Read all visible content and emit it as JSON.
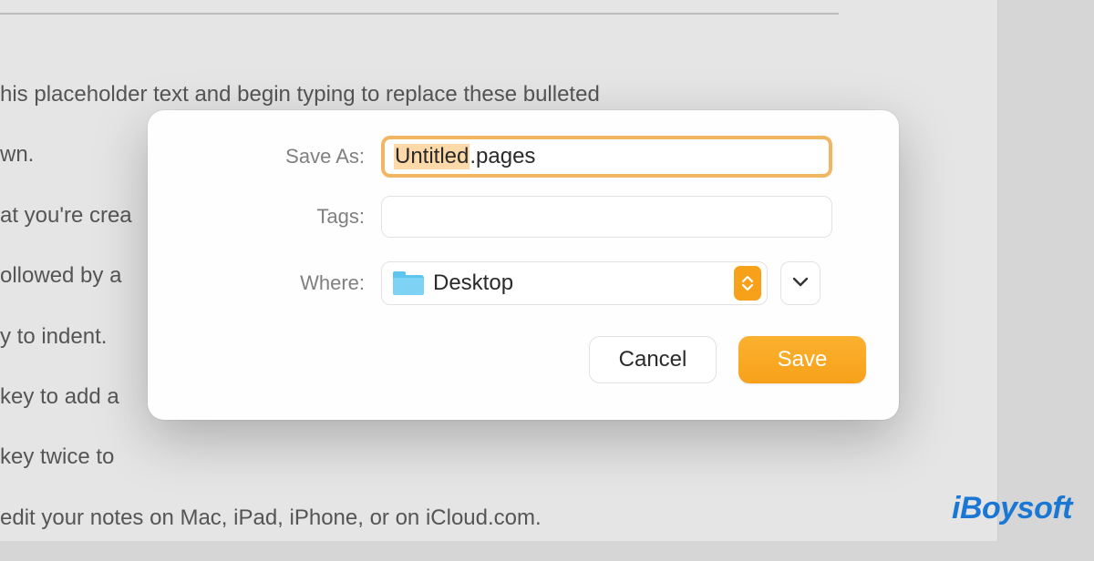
{
  "background": {
    "lines": [
      "his placeholder text and begin typing to replace these bulleted",
      "wn.",
      "at you're crea",
      "ollowed by a",
      "y to indent.",
      "key to add a",
      "key twice to",
      " edit your notes on Mac, iPad, iPhone, or on iCloud.com."
    ]
  },
  "dialog": {
    "save_as_label": "Save As:",
    "tags_label": "Tags:",
    "where_label": "Where:",
    "filename_selected": "Untitled",
    "filename_rest": ".pages",
    "where_value": "Desktop",
    "cancel_label": "Cancel",
    "save_label": "Save"
  },
  "watermark": "iBoysoft"
}
